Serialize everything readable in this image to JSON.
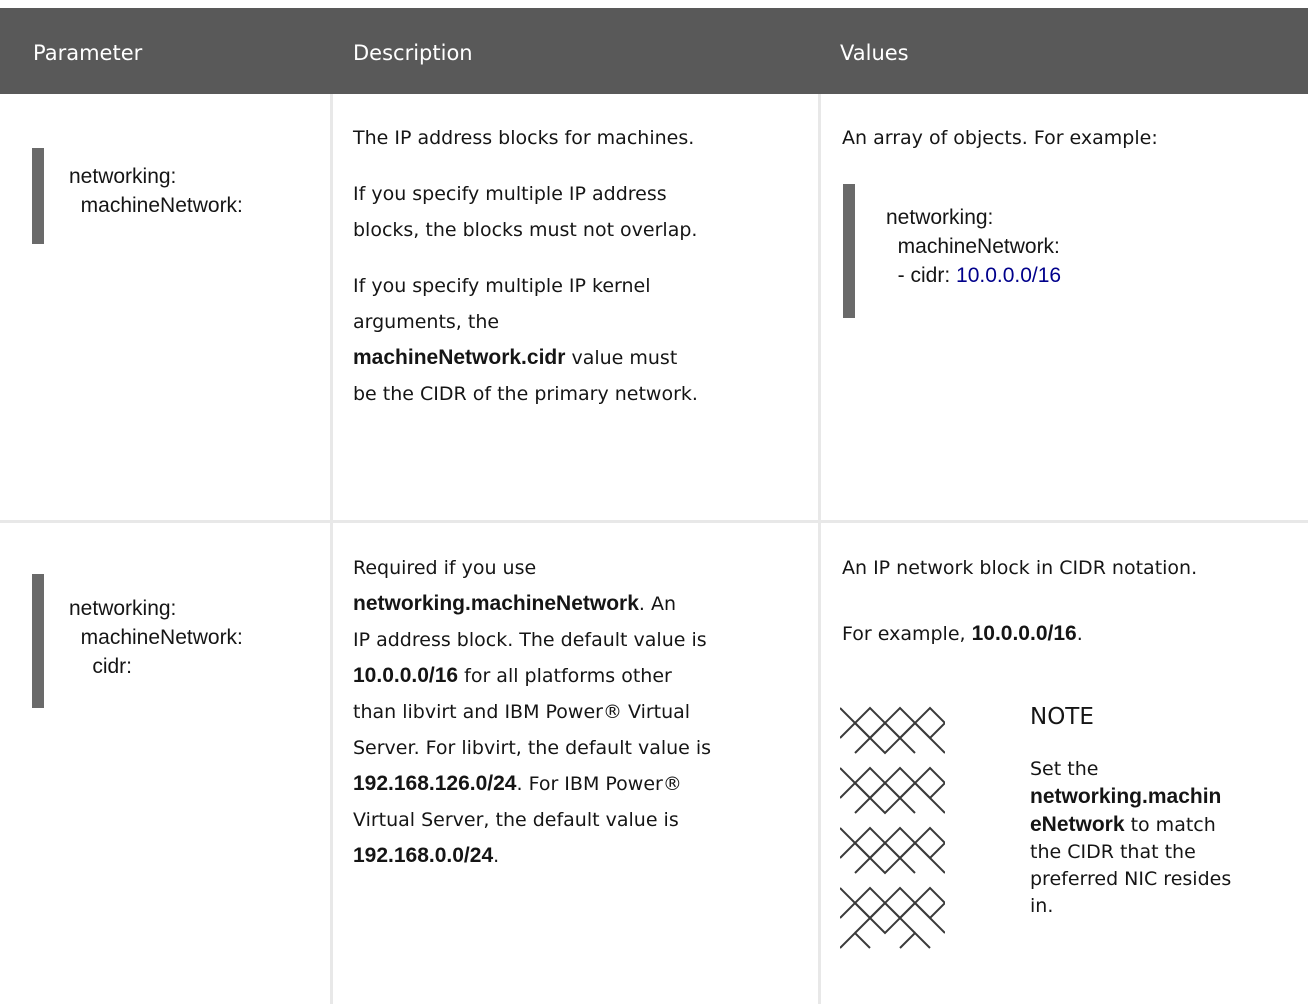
{
  "table": {
    "headers": {
      "parameter": "Parameter",
      "description": "Description",
      "values": "Values"
    },
    "rows": [
      {
        "parameter_lines": [
          "networking:",
          "  machineNetwork:"
        ],
        "description": {
          "p1": "The IP address blocks for machines.",
          "p2_line1": "If you specify multiple IP address",
          "p2_line2": "blocks, the blocks must not overlap.",
          "p3_line1": "If you specify multiple IP kernel",
          "p3_line2": "arguments, the",
          "p3_bold": "machineNetwork.cidr",
          "p3_after_bold": " value must",
          "p3_line4": "be the CIDR of the primary network."
        },
        "values": {
          "intro": "An array of objects. For example:",
          "code_line1": "networking:",
          "code_line2": "  machineNetwork:",
          "code_line3_key": "  - cidr: ",
          "code_line3_value": "10.0.0.0/16"
        }
      },
      {
        "parameter_lines": [
          "networking:",
          "  machineNetwork:",
          "    cidr:"
        ],
        "description": {
          "l1": "Required if you use",
          "l2_bold": "networking.machineNetwork",
          "l2_after": ". An",
          "l3": "IP address block. The default value is",
          "l4_bold": "10.0.0.0/16",
          "l4_after": " for all platforms other",
          "l5": "than libvirt and IBM Power® Virtual",
          "l6": "Server. For libvirt, the default value is",
          "l7_bold": "192.168.126.0/24",
          "l7_after": ". For IBM Power®",
          "l8": "Virtual Server, the default value is",
          "l9_bold": "192.168.0.0/24",
          "l9_after": "."
        },
        "values": {
          "p1": "An IP network block in CIDR notation.",
          "p2_before": "For example, ",
          "p2_bold": "10.0.0.0/16",
          "p2_after": ".",
          "note_icon": "note-pattern-icon",
          "note_title": "NOTE",
          "note_l1": "Set the",
          "note_l2_bold": "networking.machin",
          "note_l3_bold": "eNetwork",
          "note_l3_after": " to match",
          "note_l4": "the CIDR that the",
          "note_l5": "preferred NIC resides",
          "note_l6": "in."
        }
      }
    ]
  },
  "colors": {
    "header_bg": "#595959",
    "code_bar": "#6a6a6a",
    "code_value": "#00008b",
    "grid": "#e8e8e8"
  }
}
